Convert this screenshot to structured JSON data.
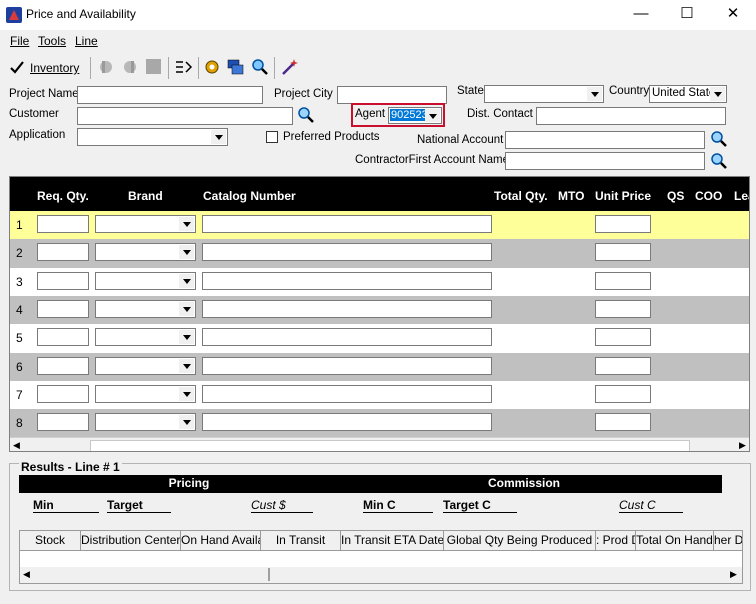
{
  "window": {
    "title": "Price and Availability",
    "minimize": "—",
    "maximize": "☐",
    "close": "✕"
  },
  "menu": {
    "file": "File",
    "tools": "Tools",
    "line": "Line"
  },
  "toolbar": {
    "inventory_label": "Inventory"
  },
  "form": {
    "project_name_label": "Project Name",
    "project_name_value": "",
    "project_city_label": "Project City",
    "project_city_value": "",
    "state_label": "State",
    "state_value": "",
    "country_label": "Country",
    "country_value": "United State",
    "customer_label": "Customer",
    "customer_value": "",
    "agent_label": "Agent",
    "agent_value": "902523",
    "dist_contact_label": "Dist. Contact",
    "dist_contact_value": "",
    "application_label": "Application",
    "application_value": "",
    "preferred_products_label": "Preferred Products",
    "national_account_label": "National Account",
    "national_account_value": "",
    "contractor_label": "ContractorFirst Account Name",
    "contractor_value": ""
  },
  "grid": {
    "columns": [
      "Req. Qty.",
      "Brand",
      "Catalog Number",
      "Total Qty.",
      "MTO",
      "Unit Price",
      "QS",
      "COO",
      "Lea"
    ],
    "rows": [
      "1",
      "2",
      "3",
      "4",
      "5",
      "6",
      "7",
      "8"
    ]
  },
  "results": {
    "title": "Results - Line # 1",
    "pricing_header": "Pricing",
    "commission_header": "Commission",
    "min_label": "Min",
    "target_label": "Target",
    "cust_label": "Cust $",
    "min_c_label": "Min C",
    "target_c_label": "Target C",
    "cust_c_label": "Cust C",
    "sub_columns": [
      "Stock",
      "Distribution Center",
      "On Hand Availa",
      "In Transit",
      "In Transit ETA Date",
      "Global Qty Being Produced",
      ": Prod D",
      "Total On Hand",
      "her D"
    ]
  },
  "colors": {
    "selected_row": "#ffff99",
    "alt_row": "#c0c0c0",
    "highlight_border": "#c8102e",
    "selection": "#0078d7"
  }
}
